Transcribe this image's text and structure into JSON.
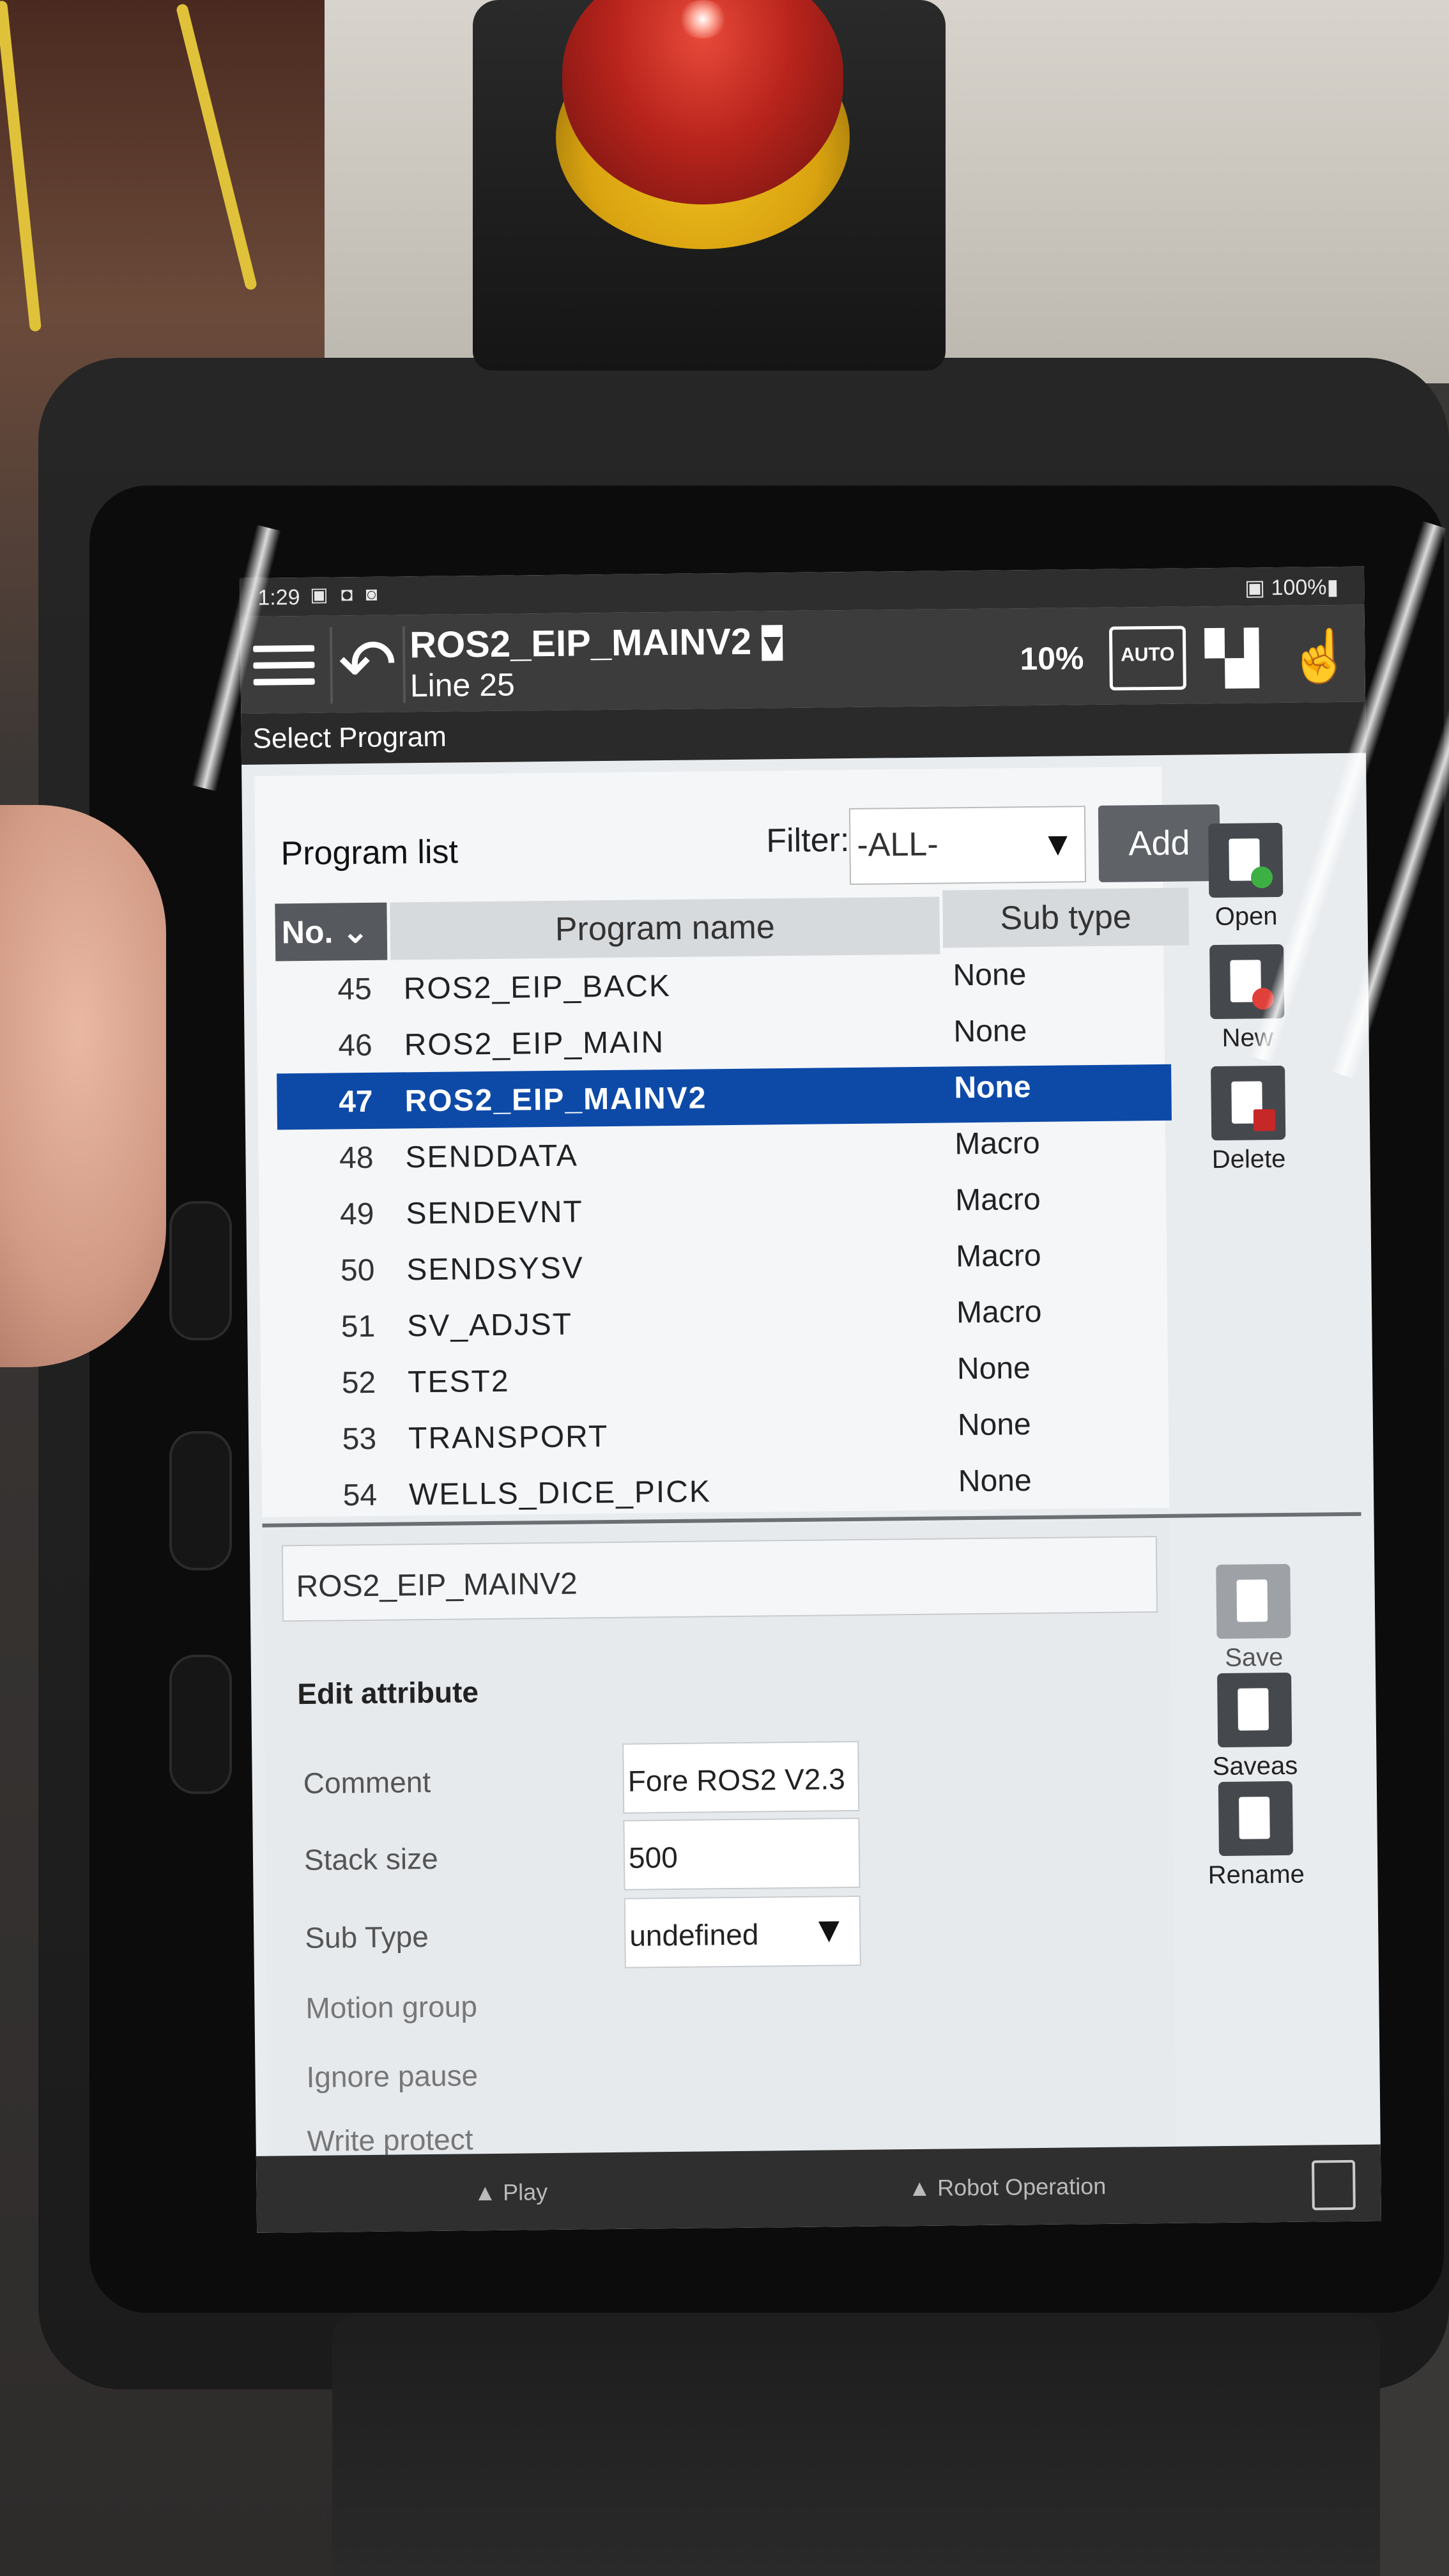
{
  "status_bar": {
    "time": "1:29",
    "notifications": "▣ ◘ ◙",
    "battery": "▣ 100%▮"
  },
  "title_bar": {
    "program": "ROS2_EIP_MAINV2",
    "program_dropdown_glyph": "▾",
    "line": "Line 25",
    "speed_override": "10%",
    "mode_label": "AUTO",
    "back_icon": "↶",
    "hold_icon_glyph": "▚▍",
    "touch_icon_glyph": "☝"
  },
  "screen_header": "Select Program",
  "program_list": {
    "label": "Program list",
    "filter_label": "Filter:",
    "filter_value": "-ALL-",
    "dropdown_arrow": "▼",
    "add_label": "Add",
    "columns": {
      "no": "No. ⌄",
      "name": "Program name",
      "subtype": "Sub type"
    },
    "rows": [
      {
        "no": "45",
        "name": "ROS2_EIP_BACK",
        "subtype": "None"
      },
      {
        "no": "46",
        "name": "ROS2_EIP_MAIN",
        "subtype": "None"
      },
      {
        "no": "47",
        "name": "ROS2_EIP_MAINV2",
        "subtype": "None",
        "selected": true
      },
      {
        "no": "48",
        "name": "SENDDATA",
        "subtype": "Macro"
      },
      {
        "no": "49",
        "name": "SENDEVNT",
        "subtype": "Macro"
      },
      {
        "no": "50",
        "name": "SENDSYSV",
        "subtype": "Macro"
      },
      {
        "no": "51",
        "name": "SV_ADJST",
        "subtype": "Macro"
      },
      {
        "no": "52",
        "name": "TEST2",
        "subtype": "None"
      },
      {
        "no": "53",
        "name": "TRANSPORT",
        "subtype": "None"
      },
      {
        "no": "54",
        "name": "WELLS_DICE_PICK",
        "subtype": "None"
      }
    ]
  },
  "side_actions": {
    "open": "Open",
    "new": "New",
    "delete": "Delete",
    "save": "Save",
    "saveas": "Saveas",
    "rename": "Rename"
  },
  "edit": {
    "program_name": "ROS2_EIP_MAINV2",
    "title": "Edit attribute",
    "comment_label": "Comment",
    "comment_value": "Fore ROS2 V2.3",
    "stack_label": "Stack size",
    "stack_value": "500",
    "subtype_label": "Sub Type",
    "subtype_value": "undefined",
    "motion_label": "Motion group",
    "ignore_label": "Ignore pause",
    "write_label": "Write protect"
  },
  "bottom_bar": {
    "play": "▲ Play",
    "robot": "▲ Robot Operation"
  },
  "colors": {
    "selection": "#0d4aa8",
    "titlebar": "#3c3c3c",
    "estop_red": "#b8241c",
    "estop_yellow": "#d9a310"
  }
}
